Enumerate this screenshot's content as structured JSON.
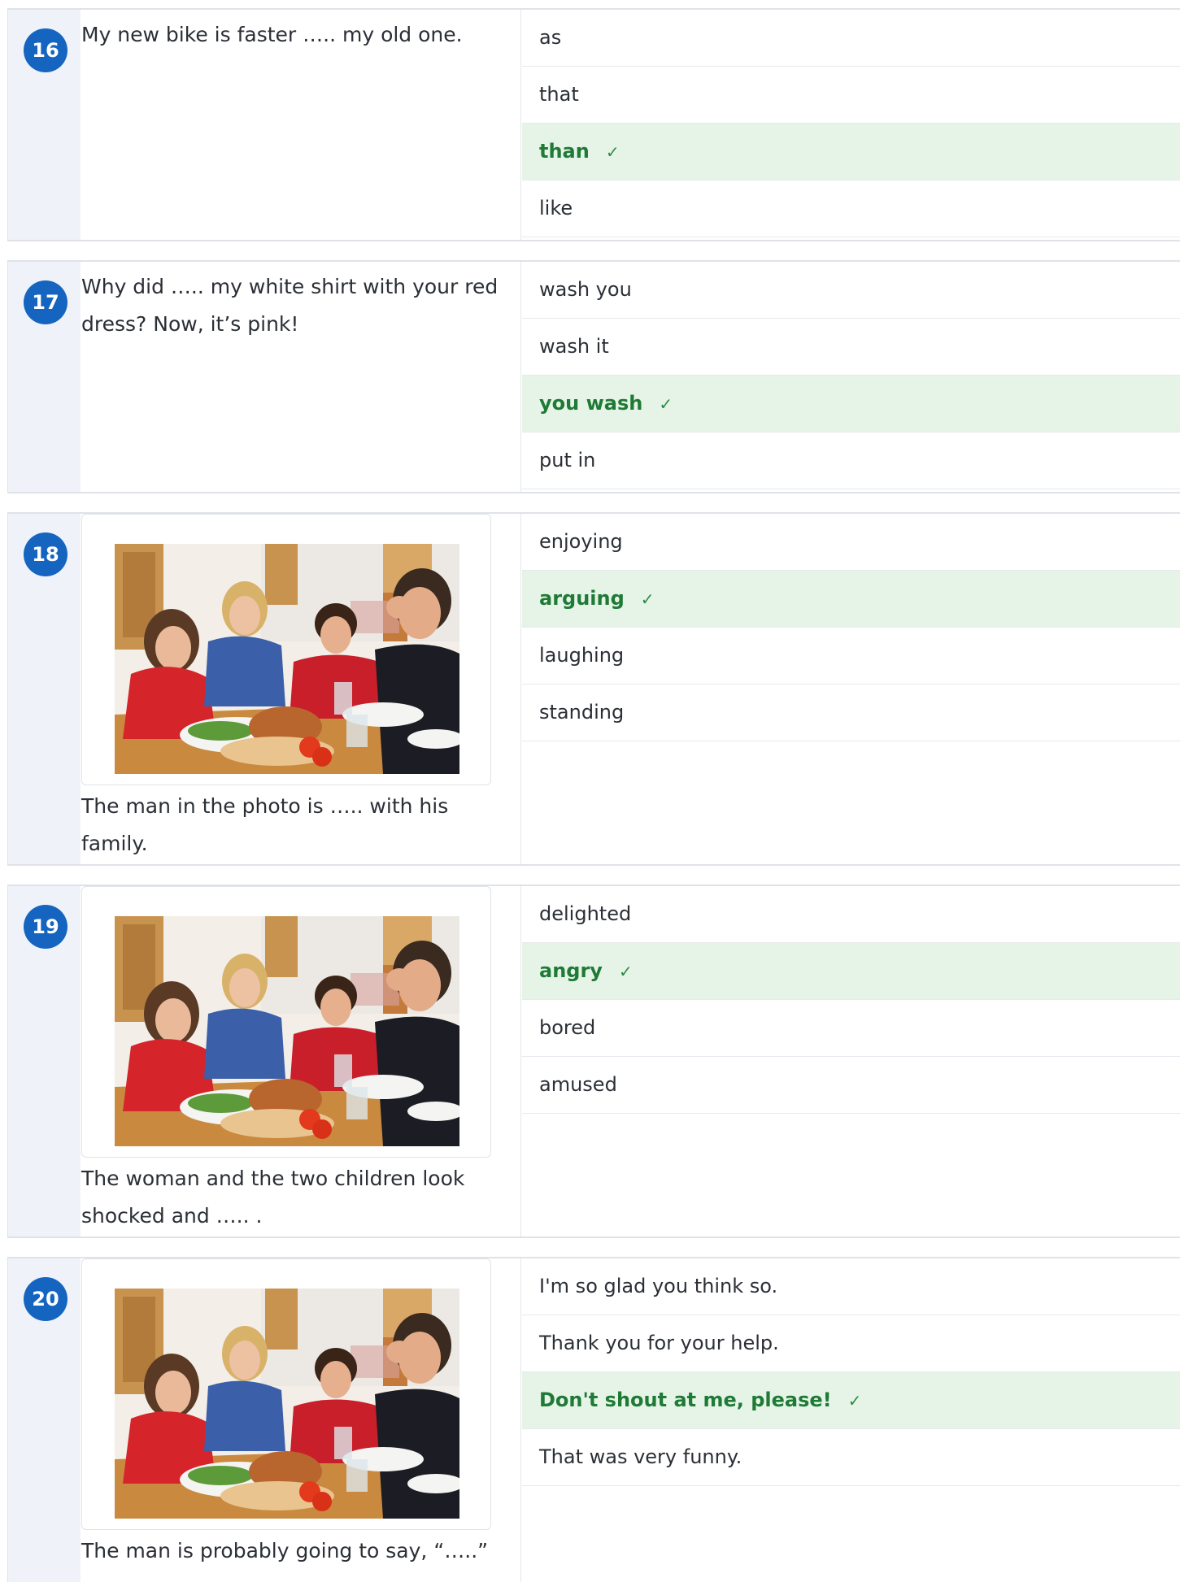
{
  "questions": [
    {
      "number": "16",
      "text": "My new bike is faster ….. my old one.",
      "options": [
        "as",
        "that",
        "than",
        "like"
      ],
      "correct_index": 2
    },
    {
      "number": "17",
      "text": "Why did ….. my white shirt with your red dress? Now, it’s pink!",
      "options": [
        "wash you",
        "wash it",
        "you wash",
        "put in"
      ],
      "correct_index": 2
    },
    {
      "number": "18",
      "text": "The man in the photo is ….. with his family.",
      "options": [
        "enjoying",
        "arguing",
        "laughing",
        "standing"
      ],
      "correct_index": 1
    },
    {
      "number": "19",
      "text": "The woman and the two children look shocked and ….. .",
      "options": [
        "delighted",
        "angry",
        "bored",
        "amused"
      ],
      "correct_index": 1
    },
    {
      "number": "20",
      "text": "The man is probably going to say, “…..”",
      "options": [
        "I'm so glad you think so.",
        "Thank you for your help.",
        "Don't shout at me, please!",
        "That was very funny."
      ],
      "correct_index": 2
    }
  ],
  "check_mark": "✓",
  "photo_icon": "family-argument-photo",
  "colors": {
    "badge": "#1565c0",
    "correct_bg": "#e6f4e8",
    "correct_text": "#1f7a36",
    "number_column_bg": "#eff3f9"
  }
}
